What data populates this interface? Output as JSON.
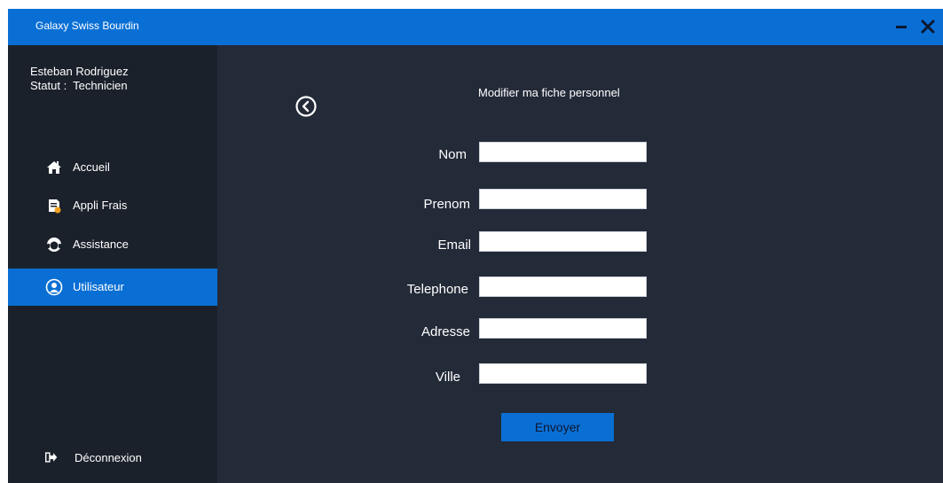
{
  "window": {
    "title": "Galaxy Swiss Bourdin"
  },
  "sidebar": {
    "user_name": "Esteban Rodriguez",
    "user_status": "Statut :  Technicien",
    "items": [
      {
        "label": "Accueil",
        "icon": "home-icon",
        "active": false
      },
      {
        "label": "Appli Frais",
        "icon": "expense-icon",
        "active": false
      },
      {
        "label": "Assistance",
        "icon": "headset-icon",
        "active": false
      },
      {
        "label": "Utilisateur",
        "icon": "user-icon",
        "active": true
      }
    ],
    "logout_label": "Déconnexion"
  },
  "form": {
    "title": "Modifier ma fiche personnel",
    "fields": [
      {
        "label": "Nom",
        "value": ""
      },
      {
        "label": "Prenom",
        "value": ""
      },
      {
        "label": "Email",
        "value": ""
      },
      {
        "label": "Telephone",
        "value": ""
      },
      {
        "label": "Adresse",
        "value": ""
      },
      {
        "label": "Ville",
        "value": ""
      }
    ],
    "submit_label": "Envoyer"
  },
  "colors": {
    "accent": "#0a6fd4",
    "sidebar_bg": "#1b212b",
    "content_bg": "#232a38"
  }
}
